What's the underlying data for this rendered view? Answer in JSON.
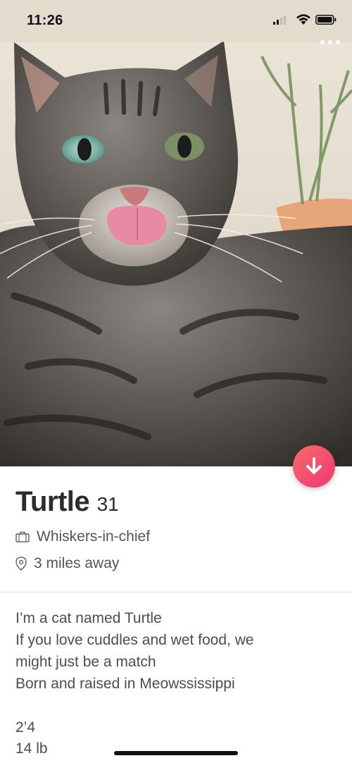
{
  "status_bar": {
    "time": "11:26"
  },
  "profile": {
    "name": "Turtle",
    "age": "31",
    "job": "Whiskers-in-chief",
    "distance": "3 miles away",
    "bio": [
      "I’m a cat named Turtle",
      "If you love cuddles and wet food, we",
      "might just be a match",
      "Born and raised in Meowssissippi"
    ],
    "stats": [
      "2’4",
      "14 lb"
    ]
  },
  "icons": {
    "job": "briefcase-icon",
    "location": "location-pin-icon",
    "collapse": "arrow-down-icon"
  },
  "colors": {
    "accent_start": "#f66a6a",
    "accent_end": "#ee3a72"
  }
}
